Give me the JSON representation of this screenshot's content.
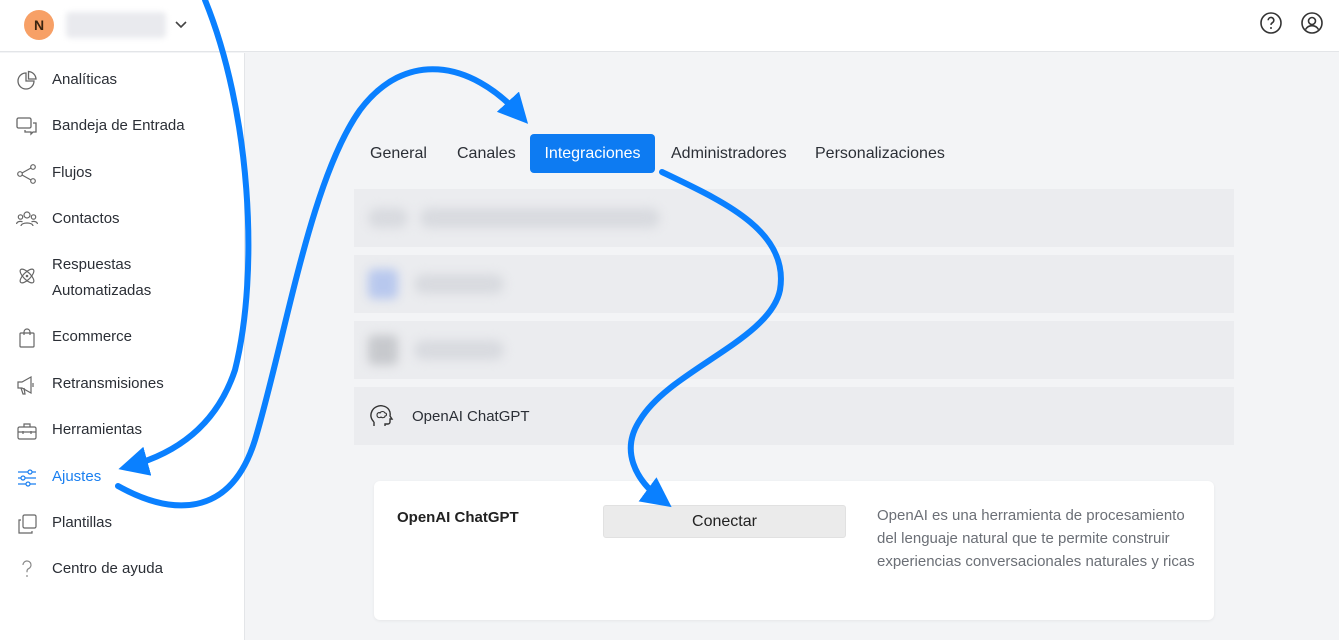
{
  "header": {
    "avatar_initial": "N",
    "workspace_name": "",
    "icons": [
      "chevron-down-icon",
      "help-circle-icon",
      "user-circle-icon"
    ]
  },
  "sidebar": {
    "items": [
      {
        "label": "Analíticas",
        "icon": "pie-chart-icon"
      },
      {
        "label": "Bandeja de Entrada",
        "icon": "chat-bubbles-icon"
      },
      {
        "label": "Flujos",
        "icon": "flow-share-icon"
      },
      {
        "label": "Contactos",
        "icon": "users-icon"
      },
      {
        "label": "Respuestas Automatizadas",
        "icon": "atom-icon"
      },
      {
        "label": "Ecommerce",
        "icon": "shopping-bag-icon"
      },
      {
        "label": "Retransmisiones",
        "icon": "megaphone-icon"
      },
      {
        "label": "Herramientas",
        "icon": "toolbox-icon"
      },
      {
        "label": "Ajustes",
        "icon": "sliders-icon",
        "active": true
      },
      {
        "label": "Plantillas",
        "icon": "copy-icon"
      },
      {
        "label": "Centro de ayuda",
        "icon": "question-mark-icon"
      }
    ]
  },
  "tabs": [
    {
      "label": "General"
    },
    {
      "label": "Canales"
    },
    {
      "label": "Integraciones",
      "active": true
    },
    {
      "label": "Administradores"
    },
    {
      "label": "Personalizaciones"
    }
  ],
  "integrations": {
    "items": [
      {
        "name": "",
        "blurred": true
      },
      {
        "name": "",
        "blurred": true
      },
      {
        "name": "",
        "blurred": true
      },
      {
        "name": "OpenAI ChatGPT",
        "icon": "brain-head-icon"
      }
    ]
  },
  "detail": {
    "title": "OpenAI ChatGPT",
    "connect_label": "Conectar",
    "description": "OpenAI es una herramienta de procesamiento del lenguaje natural que te permite construir experiencias conversacionales naturales y ricas"
  },
  "colors": {
    "accent": "#0d7bf2",
    "arrow": "#0a80ff",
    "avatar": "#f7a066"
  }
}
